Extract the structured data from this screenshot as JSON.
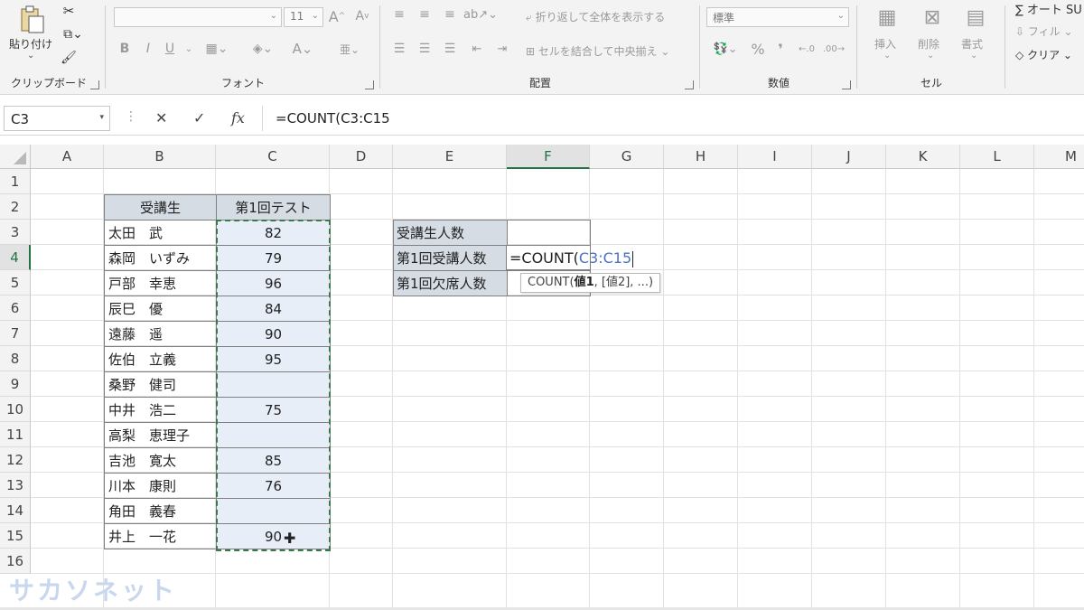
{
  "ribbon": {
    "clipboard": {
      "label": "クリップボード",
      "paste_label": "貼り付け"
    },
    "font": {
      "label": "フォント",
      "font_name": "",
      "font_size": "11",
      "bold": "B",
      "italic": "I",
      "underline": "U"
    },
    "alignment": {
      "label": "配置",
      "wrap_text": "折り返して全体を表示する",
      "merge_center": "セルを結合して中央揃え"
    },
    "number": {
      "label": "数値",
      "format": "標準",
      "percent": "%"
    },
    "cells": {
      "label": "セル",
      "insert": "挿入",
      "delete": "削除",
      "format": "書式"
    },
    "editing": {
      "autosum": "オート SU",
      "fill": "フィル",
      "clear": "クリア"
    }
  },
  "formula_bar": {
    "name_box": "C3",
    "formula": "=COUNT(C3:C15"
  },
  "columns": [
    "A",
    "B",
    "C",
    "D",
    "E",
    "F",
    "G",
    "H",
    "I",
    "J",
    "K",
    "L",
    "M"
  ],
  "active_column": "F",
  "rows": [
    "1",
    "2",
    "3",
    "4",
    "5",
    "6",
    "7",
    "8",
    "9",
    "10",
    "11",
    "12",
    "13",
    "14",
    "15",
    "16"
  ],
  "active_row": "4",
  "table": {
    "header_name": "受講生",
    "header_score": "第1回テスト",
    "students": [
      {
        "name": "太田　武",
        "score": "82"
      },
      {
        "name": "森岡　いずみ",
        "score": "79"
      },
      {
        "name": "戸部　幸恵",
        "score": "96"
      },
      {
        "name": "辰巳　優",
        "score": "84"
      },
      {
        "name": "遠藤　遥",
        "score": "90"
      },
      {
        "name": "佐伯　立義",
        "score": "95"
      },
      {
        "name": "桑野　健司",
        "score": ""
      },
      {
        "name": "中井　浩二",
        "score": "75"
      },
      {
        "name": "高梨　恵理子",
        "score": ""
      },
      {
        "name": "吉池　寛太",
        "score": "85"
      },
      {
        "name": "川本　康則",
        "score": "76"
      },
      {
        "name": "角田　義春",
        "score": ""
      },
      {
        "name": "井上　一花",
        "score": "90"
      }
    ]
  },
  "summary": {
    "labels": [
      "受講生人数",
      "第1回受講人数",
      "第1回欠席人数"
    ],
    "editing_prefix": "=COUNT(",
    "editing_ref": "C3:C15",
    "tooltip_fn": "COUNT(",
    "tooltip_arg1": "値1",
    "tooltip_rest": ", [値2], ...)"
  },
  "watermark": "サカソネット",
  "colors": {
    "accent": "#217346",
    "header_fill": "#d6dce4",
    "selection_fill": "#e8eef8",
    "ref_blue": "#4a72c4"
  }
}
